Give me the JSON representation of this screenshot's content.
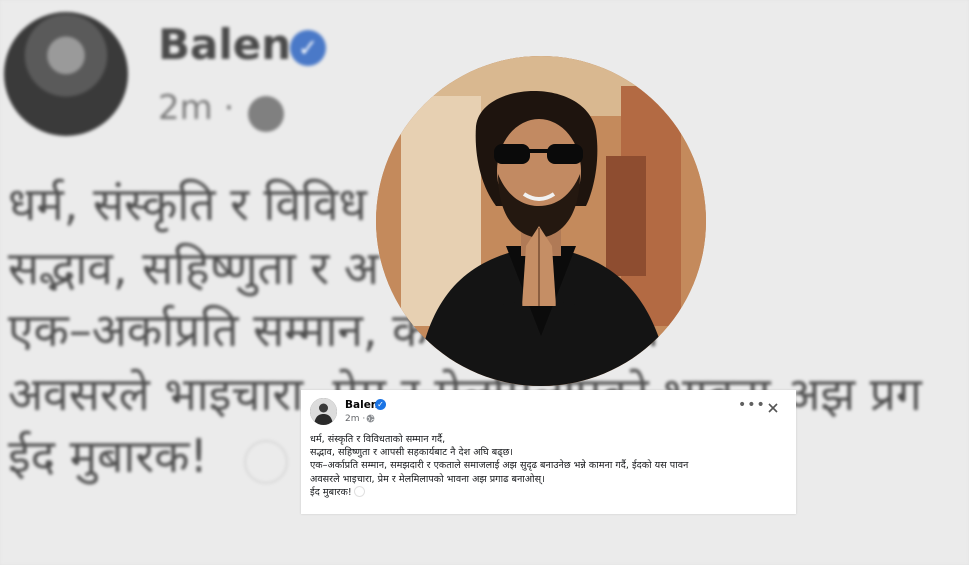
{
  "post": {
    "author": "Balen",
    "verified_icon": "verified-badge-icon",
    "time": "2m ·",
    "audience_icon": "globe-icon",
    "lines": [
      "धर्म, संस्कृति र विविधताको सम्मान गर्दै,",
      "सद्भाव, सहिष्णुता र आपसी सहकार्यबाट नै देश अघि बढ्छ।",
      "एक–अर्काप्रति सम्मान, समझदारी र एकताले समाजलाई अझ सुदृढ बनाउनेछ भन्ने कामना गर्दै, ईदको यस पावन",
      "अवसरले भाइचारा, प्रेम र मेलमिलापको भावना अझ प्रगाढ बनाओस्।",
      "ईद मुबारक!"
    ],
    "more_icon": "more-options-icon",
    "close_icon": "close-icon"
  },
  "background": {
    "name": "Balen",
    "time": "2m ·",
    "lines": [
      "धर्म, संस्कृति र विविध",
      "सद्भाव, सहिष्णुता र अ                              ट नै देश अघि ब",
      "एक–अर्काप्रति सम्मान,                            कताले समाजला",
      "अवसरले भाइचारा, प्रेम र मेलमिलापको भावना अझ प्रग",
      "ईद मुबारक!"
    ]
  },
  "colors": {
    "verified_blue": "#1b74e4",
    "text": "#1c1e21",
    "secondary_text": "#65676b"
  }
}
